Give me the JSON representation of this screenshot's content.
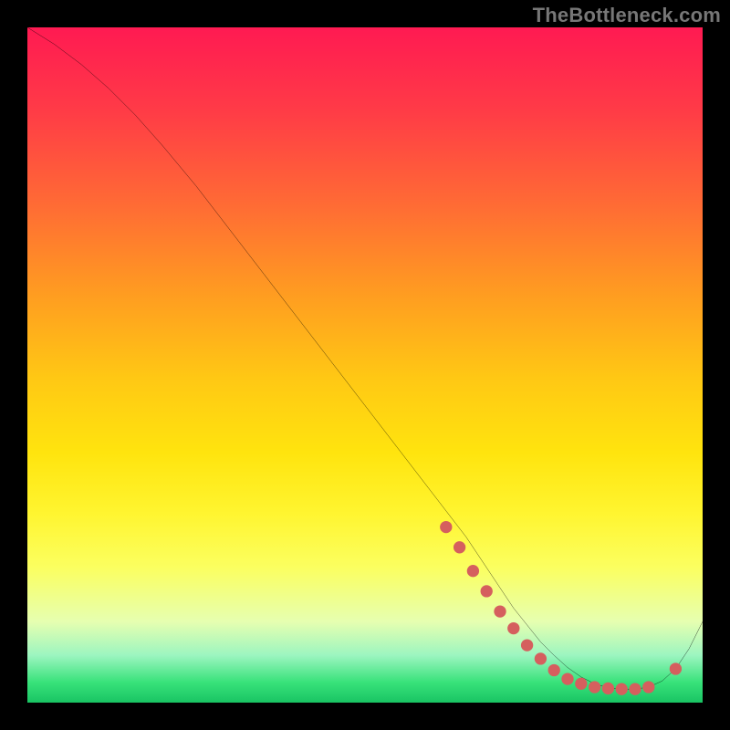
{
  "watermark": "TheBottleneck.com",
  "chart_data": {
    "type": "line",
    "title": "",
    "xlabel": "",
    "ylabel": "",
    "xlim": [
      0,
      100
    ],
    "ylim": [
      0,
      100
    ],
    "series": [
      {
        "name": "bottleneck-curve",
        "x": [
          0,
          4,
          8,
          12,
          16,
          20,
          25,
          30,
          35,
          40,
          45,
          50,
          55,
          60,
          65,
          68,
          70,
          72,
          74,
          76,
          78,
          80,
          82,
          84,
          86,
          88,
          90,
          92,
          94,
          96,
          98,
          100
        ],
        "y": [
          100,
          97.5,
          94.5,
          91,
          87,
          82.5,
          76.5,
          70,
          63.5,
          57,
          50.5,
          44,
          37.5,
          31,
          24.5,
          20,
          17,
          14,
          11.5,
          9,
          7,
          5.2,
          3.8,
          2.8,
          2.2,
          2,
          2,
          2.3,
          3.2,
          5,
          8,
          12
        ]
      }
    ],
    "markers": {
      "name": "highlight-points",
      "x": [
        62,
        64,
        66,
        68,
        70,
        72,
        74,
        76,
        78,
        80,
        82,
        84,
        86,
        88,
        90,
        92,
        96
      ],
      "y": [
        26,
        23,
        19.5,
        16.5,
        13.5,
        11,
        8.5,
        6.5,
        4.8,
        3.5,
        2.8,
        2.3,
        2.1,
        2,
        2,
        2.3,
        5
      ]
    },
    "colors": {
      "curve": "#000000",
      "markers": "#d55f5e",
      "gradient_top": "#ff1a52",
      "gradient_bottom": "#19c463"
    }
  }
}
